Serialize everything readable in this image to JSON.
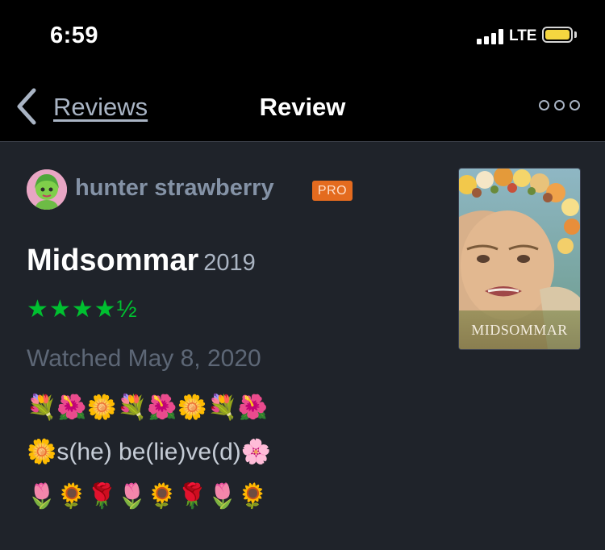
{
  "status_bar": {
    "time": "6:59",
    "network": "LTE",
    "battery_color": "#f5d640"
  },
  "nav": {
    "back_icon": "chevron-left-icon",
    "back_label": "Reviews",
    "title": "Review",
    "more_icon": "more-options-icon"
  },
  "review": {
    "author": "hunter strawberry",
    "badge": "PRO",
    "film_title": "Midsommar",
    "film_year": "2019",
    "rating": 4.5,
    "rating_text": "★★★★½",
    "watched": "Watched May 8, 2020",
    "body_lines": [
      "💐🌺🌼💐🌺🌼💐🌺",
      "🌼s(he) be(lie)ve(d)🌸",
      "🌷🌻🌹🌷🌻🌹🌷🌻"
    ]
  },
  "poster": {
    "title": "MIDSOMMAR"
  },
  "colors": {
    "accent_green": "#00c030",
    "pro_orange": "#e46b1f",
    "background": "#1f232a"
  }
}
